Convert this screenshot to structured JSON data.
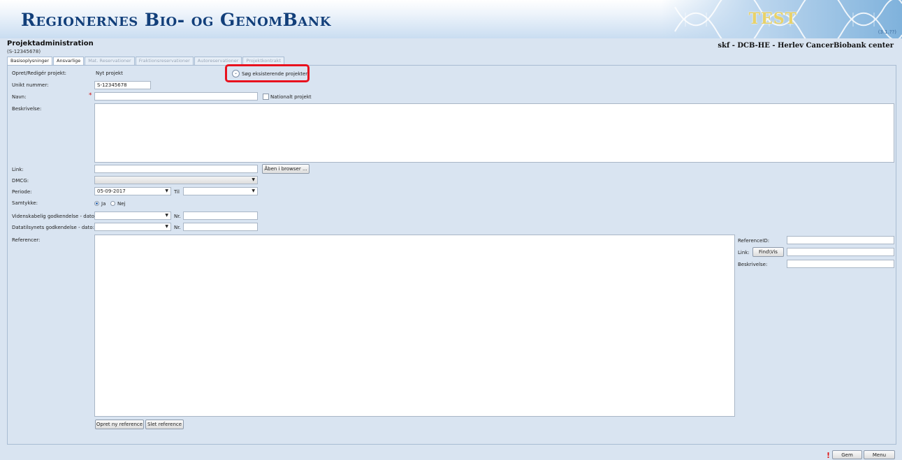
{
  "app": {
    "title": "Regionernes Bio- og GenomBank",
    "test_badge": "TEST",
    "version": "(3.1.??)"
  },
  "header": {
    "page_title": "Projektadministration",
    "project_id": "(S-12345678)",
    "user_info": "skf - DCB-HE - Herlev CancerBiobank center"
  },
  "tabs": [
    {
      "label": "Basisoplysninger",
      "active": true
    },
    {
      "label": "Ansvarlige",
      "active": true
    },
    {
      "label": "Mat. Reservationer",
      "active": false
    },
    {
      "label": "Fraktionsreservationer",
      "active": false
    },
    {
      "label": "Autoreservationer",
      "active": false
    },
    {
      "label": "Projektkontrakt",
      "active": false
    }
  ],
  "form": {
    "opret_label": "Opret/Redigér projekt:",
    "opret_value": "Nyt projekt",
    "search_existing": "Søg eksisterende projekter",
    "unikt_label": "Unikt nummer:",
    "unikt_value": "S-12345678",
    "navn_label": "Navn:",
    "required_mark": "*",
    "national_label": "Nationalt projekt",
    "beskrivelse_label": "Beskrivelse:",
    "link_label": "Link:",
    "open_browser": "Åben i browser ...",
    "dmcg_label": "DMCG:",
    "periode_label": "Periode:",
    "periode_from": "05-09-2017",
    "til_label": "Til",
    "samtykke_label": "Samtykke:",
    "ja": "Ja",
    "nej": "Nej",
    "vidensk_label": "Videnskabelig godkendelse - dato:",
    "datatil_label": "Datatilsynets godkendelse - dato:",
    "nr_label": "Nr.",
    "referencer_label": "Referencer:",
    "ref_id_label": "ReferenceID:",
    "ref_link_label": "Link:",
    "find_vis": "Find\\Vis",
    "ref_beskrivelse_label": "Beskrivelse:",
    "opret_reference": "Opret ny reference",
    "slet_reference": "Slet reference"
  },
  "footer": {
    "gem": "Gem",
    "menu": "Menu",
    "marker": "!"
  },
  "colors": {
    "brand": "#123f7a",
    "highlight": "#e8111e",
    "background": "#d9e4f1"
  }
}
